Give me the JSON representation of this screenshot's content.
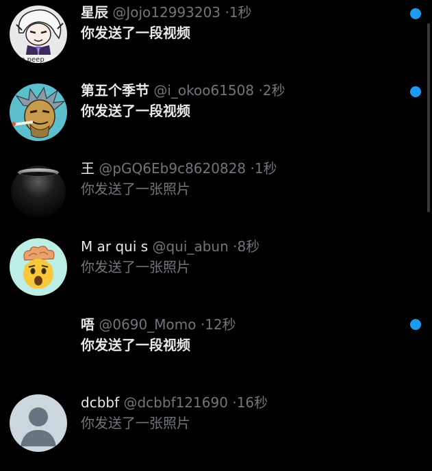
{
  "colors": {
    "background": "#000000",
    "primary_text": "#e7e9ea",
    "secondary_text": "#71767b",
    "unread_dot": "#1d9bf0"
  },
  "conversations": [
    {
      "name": "星辰",
      "handle": "@Jojo12993203",
      "separator": "·",
      "time": "1秒",
      "preview": "你发送了一段视频",
      "unread": true,
      "avatar_icon": "anime-character-avatar-icon",
      "avatar_text": "ne peep"
    },
    {
      "name": "第五个季节",
      "handle": "@i_okoo61508",
      "separator": "·",
      "time": "2秒",
      "preview": "你发送了一段视频",
      "unread": true,
      "avatar_icon": "cartoon-old-man-smoking-avatar-icon"
    },
    {
      "name": "王",
      "handle": "@pGQ6Eb9c8620828",
      "separator": "·",
      "time": "1秒",
      "preview": "你发送了一张照片",
      "unread": false,
      "avatar_icon": "dark-sphere-avatar-icon"
    },
    {
      "name": "M ar qui s",
      "handle": "@qui_abun",
      "separator": "·",
      "time": "8秒",
      "preview": "你发送了一张照片",
      "unread": false,
      "avatar_icon": "mind-blown-emoji-avatar-icon"
    },
    {
      "name": "唔",
      "handle": "@0690_Momo",
      "separator": "·",
      "time": "12秒",
      "preview": "你发送了一段视频",
      "unread": true,
      "avatar_icon": "no-avatar"
    },
    {
      "name": "dcbbf",
      "handle": "@dcbbf121690",
      "separator": "·",
      "time": "16秒",
      "preview": "你发送了一张照片",
      "unread": false,
      "avatar_icon": "default-user-silhouette-avatar-icon"
    }
  ]
}
